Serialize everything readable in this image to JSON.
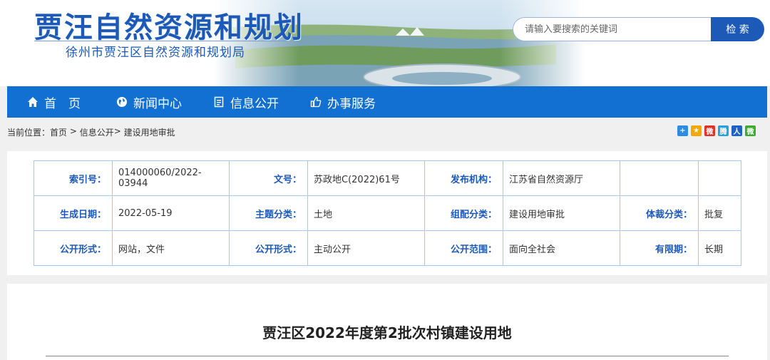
{
  "header": {
    "title": "贾汪自然资源和规划",
    "subtitle": "徐州市贾汪区自然资源和规划局",
    "search_placeholder": "请输入要搜索的关键词",
    "search_button": "检 索"
  },
  "nav": {
    "items": [
      {
        "label": "首　页",
        "icon": "home-icon"
      },
      {
        "label": "新闻中心",
        "icon": "globe-icon"
      },
      {
        "label": "信息公开",
        "icon": "document-icon"
      },
      {
        "label": "办事服务",
        "icon": "thumbs-up-icon"
      }
    ]
  },
  "breadcrumb": {
    "prefix": "当前位置：",
    "home": "首页",
    "sep1": " > ",
    "section": "信息公开",
    "sep2": "> ",
    "current": "建设用地审批"
  },
  "share_icons": [
    {
      "name": "share-more-icon",
      "glyph": "+",
      "color": "#2f8be0"
    },
    {
      "name": "qzone-icon",
      "glyph": "★",
      "color": "#f2a800"
    },
    {
      "name": "weibo-icon",
      "glyph": "微",
      "color": "#e0312a"
    },
    {
      "name": "tencent-weibo-icon",
      "glyph": "腾",
      "color": "#2c9fe0"
    },
    {
      "name": "renren-icon",
      "glyph": "人",
      "color": "#1e63c4"
    },
    {
      "name": "wechat-icon",
      "glyph": "微",
      "color": "#3aae2a"
    }
  ],
  "meta": {
    "row1": {
      "k1": "索引号：",
      "v1": "014000060/2022-03944",
      "k2": "文号：",
      "v2": "苏政地C(2022)61号",
      "k3": "发布机构：",
      "v3": "江苏省自然资源厅",
      "k4": "",
      "v4": ""
    },
    "row2": {
      "k1": "生成日期：",
      "v1": "2022-05-19",
      "k2": "主题分类：",
      "v2": "土地",
      "k3": "组配分类：",
      "v3": "建设用地审批",
      "k4": "体裁分类：",
      "v4": "批复"
    },
    "row3": {
      "k1": "公开形式：",
      "v1": "网站，文件",
      "k2": "公开形式：",
      "v2": "主动公开",
      "k3": "公开范围：",
      "v3": "面向全社会",
      "k4": "有限期：",
      "v4": "长期"
    }
  },
  "article": {
    "title": "贾汪区2022年度第2批次村镇建设用地"
  },
  "colors": {
    "brand_blue": "#1d5ab8",
    "nav_blue": "#1370d3",
    "table_border": "#a8c8ea"
  }
}
